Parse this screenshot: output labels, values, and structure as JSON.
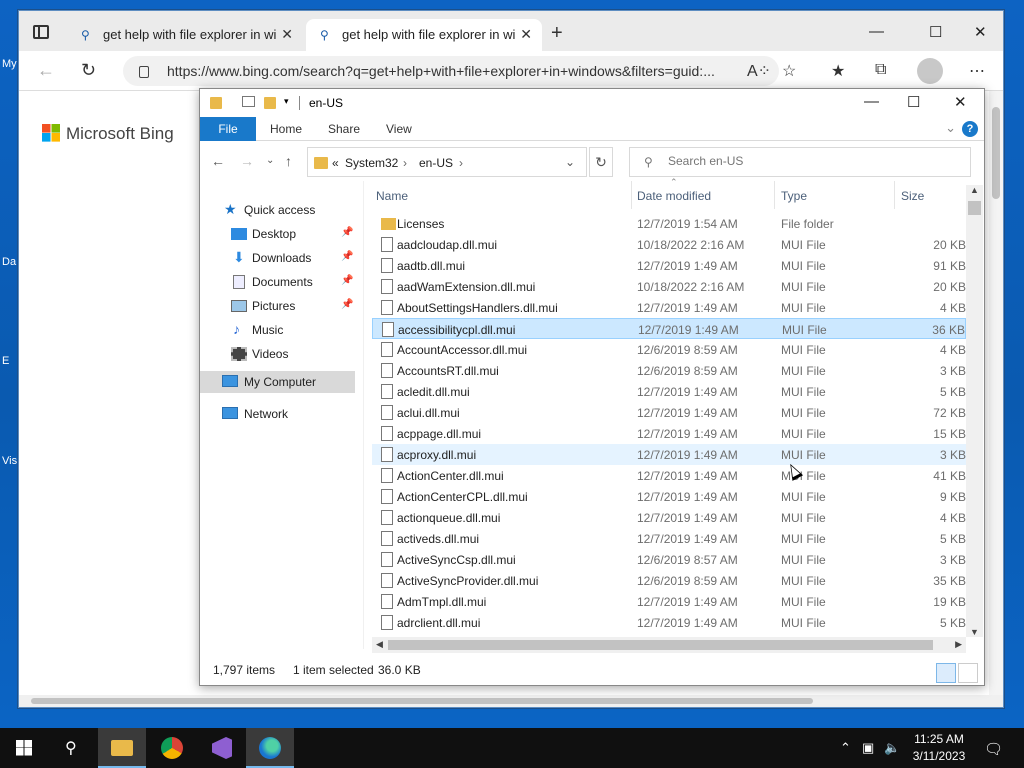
{
  "desktop": {
    "labels": [
      "My",
      "Da",
      "E",
      "Vis"
    ]
  },
  "browser": {
    "tabs": [
      {
        "label": "get help with file explorer in wind",
        "active": false
      },
      {
        "label": "get help with file explorer in wind",
        "active": true
      }
    ],
    "url": "https://www.bing.com/search?q=get+help+with+file+explorer+in+windows&filters=guid:...",
    "brand": "Microsoft Bing"
  },
  "explorer": {
    "title": "en-US",
    "ribbon": {
      "file": "File",
      "home": "Home",
      "share": "Share",
      "view": "View",
      "help": "?"
    },
    "breadcrumb": {
      "overflow": "«",
      "items": [
        "System32",
        "en-US"
      ]
    },
    "search_placeholder": "Search en-US",
    "nav": {
      "quick_access": "Quick access",
      "desktop": "Desktop",
      "downloads": "Downloads",
      "documents": "Documents",
      "pictures": "Pictures",
      "music": "Music",
      "videos": "Videos",
      "my_computer": "My Computer",
      "network": "Network"
    },
    "columns": {
      "name": "Name",
      "date": "Date modified",
      "type": "Type",
      "size": "Size"
    },
    "files": [
      {
        "name": "Licenses",
        "date": "12/7/2019 1:54 AM",
        "type": "File folder",
        "size": ""
      },
      {
        "name": "aadcloudap.dll.mui",
        "date": "10/18/2022 2:16 AM",
        "type": "MUI File",
        "size": "20 KB"
      },
      {
        "name": "aadtb.dll.mui",
        "date": "12/7/2019 1:49 AM",
        "type": "MUI File",
        "size": "91 KB"
      },
      {
        "name": "aadWamExtension.dll.mui",
        "date": "10/18/2022 2:16 AM",
        "type": "MUI File",
        "size": "20 KB"
      },
      {
        "name": "AboutSettingsHandlers.dll.mui",
        "date": "12/7/2019 1:49 AM",
        "type": "MUI File",
        "size": "4 KB"
      },
      {
        "name": "accessibilitycpl.dll.mui",
        "date": "12/7/2019 1:49 AM",
        "type": "MUI File",
        "size": "36 KB"
      },
      {
        "name": "AccountAccessor.dll.mui",
        "date": "12/6/2019 8:59 AM",
        "type": "MUI File",
        "size": "4 KB"
      },
      {
        "name": "AccountsRT.dll.mui",
        "date": "12/6/2019 8:59 AM",
        "type": "MUI File",
        "size": "3 KB"
      },
      {
        "name": "acledit.dll.mui",
        "date": "12/7/2019 1:49 AM",
        "type": "MUI File",
        "size": "5 KB"
      },
      {
        "name": "aclui.dll.mui",
        "date": "12/7/2019 1:49 AM",
        "type": "MUI File",
        "size": "72 KB"
      },
      {
        "name": "acppage.dll.mui",
        "date": "12/7/2019 1:49 AM",
        "type": "MUI File",
        "size": "15 KB"
      },
      {
        "name": "acproxy.dll.mui",
        "date": "12/7/2019 1:49 AM",
        "type": "MUI File",
        "size": "3 KB"
      },
      {
        "name": "ActionCenter.dll.mui",
        "date": "12/7/2019 1:49 AM",
        "type": "MUI File",
        "size": "41 KB"
      },
      {
        "name": "ActionCenterCPL.dll.mui",
        "date": "12/7/2019 1:49 AM",
        "type": "MUI File",
        "size": "9 KB"
      },
      {
        "name": "actionqueue.dll.mui",
        "date": "12/7/2019 1:49 AM",
        "type": "MUI File",
        "size": "4 KB"
      },
      {
        "name": "activeds.dll.mui",
        "date": "12/7/2019 1:49 AM",
        "type": "MUI File",
        "size": "5 KB"
      },
      {
        "name": "ActiveSyncCsp.dll.mui",
        "date": "12/6/2019 8:57 AM",
        "type": "MUI File",
        "size": "3 KB"
      },
      {
        "name": "ActiveSyncProvider.dll.mui",
        "date": "12/6/2019 8:59 AM",
        "type": "MUI File",
        "size": "35 KB"
      },
      {
        "name": "AdmTmpl.dll.mui",
        "date": "12/7/2019 1:49 AM",
        "type": "MUI File",
        "size": "19 KB"
      },
      {
        "name": "adrclient.dll.mui",
        "date": "12/7/2019 1:49 AM",
        "type": "MUI File",
        "size": "5 KB"
      }
    ],
    "selected_index": 5,
    "hover_index": 11,
    "status": {
      "count": "1,797 items",
      "selected": "1 item selected",
      "size": "36.0 KB"
    }
  },
  "taskbar": {
    "apps": [
      "start-icon",
      "search-icon",
      "file-explorer-icon",
      "chrome-icon",
      "visual-studio-icon",
      "edge-icon"
    ],
    "time": "11:25 AM",
    "date": "3/11/2023"
  },
  "colors": {
    "accent": "#1979ca",
    "selection": "#cce8ff",
    "desktop": "#0a5fb4",
    "taskbar": "#101010"
  }
}
